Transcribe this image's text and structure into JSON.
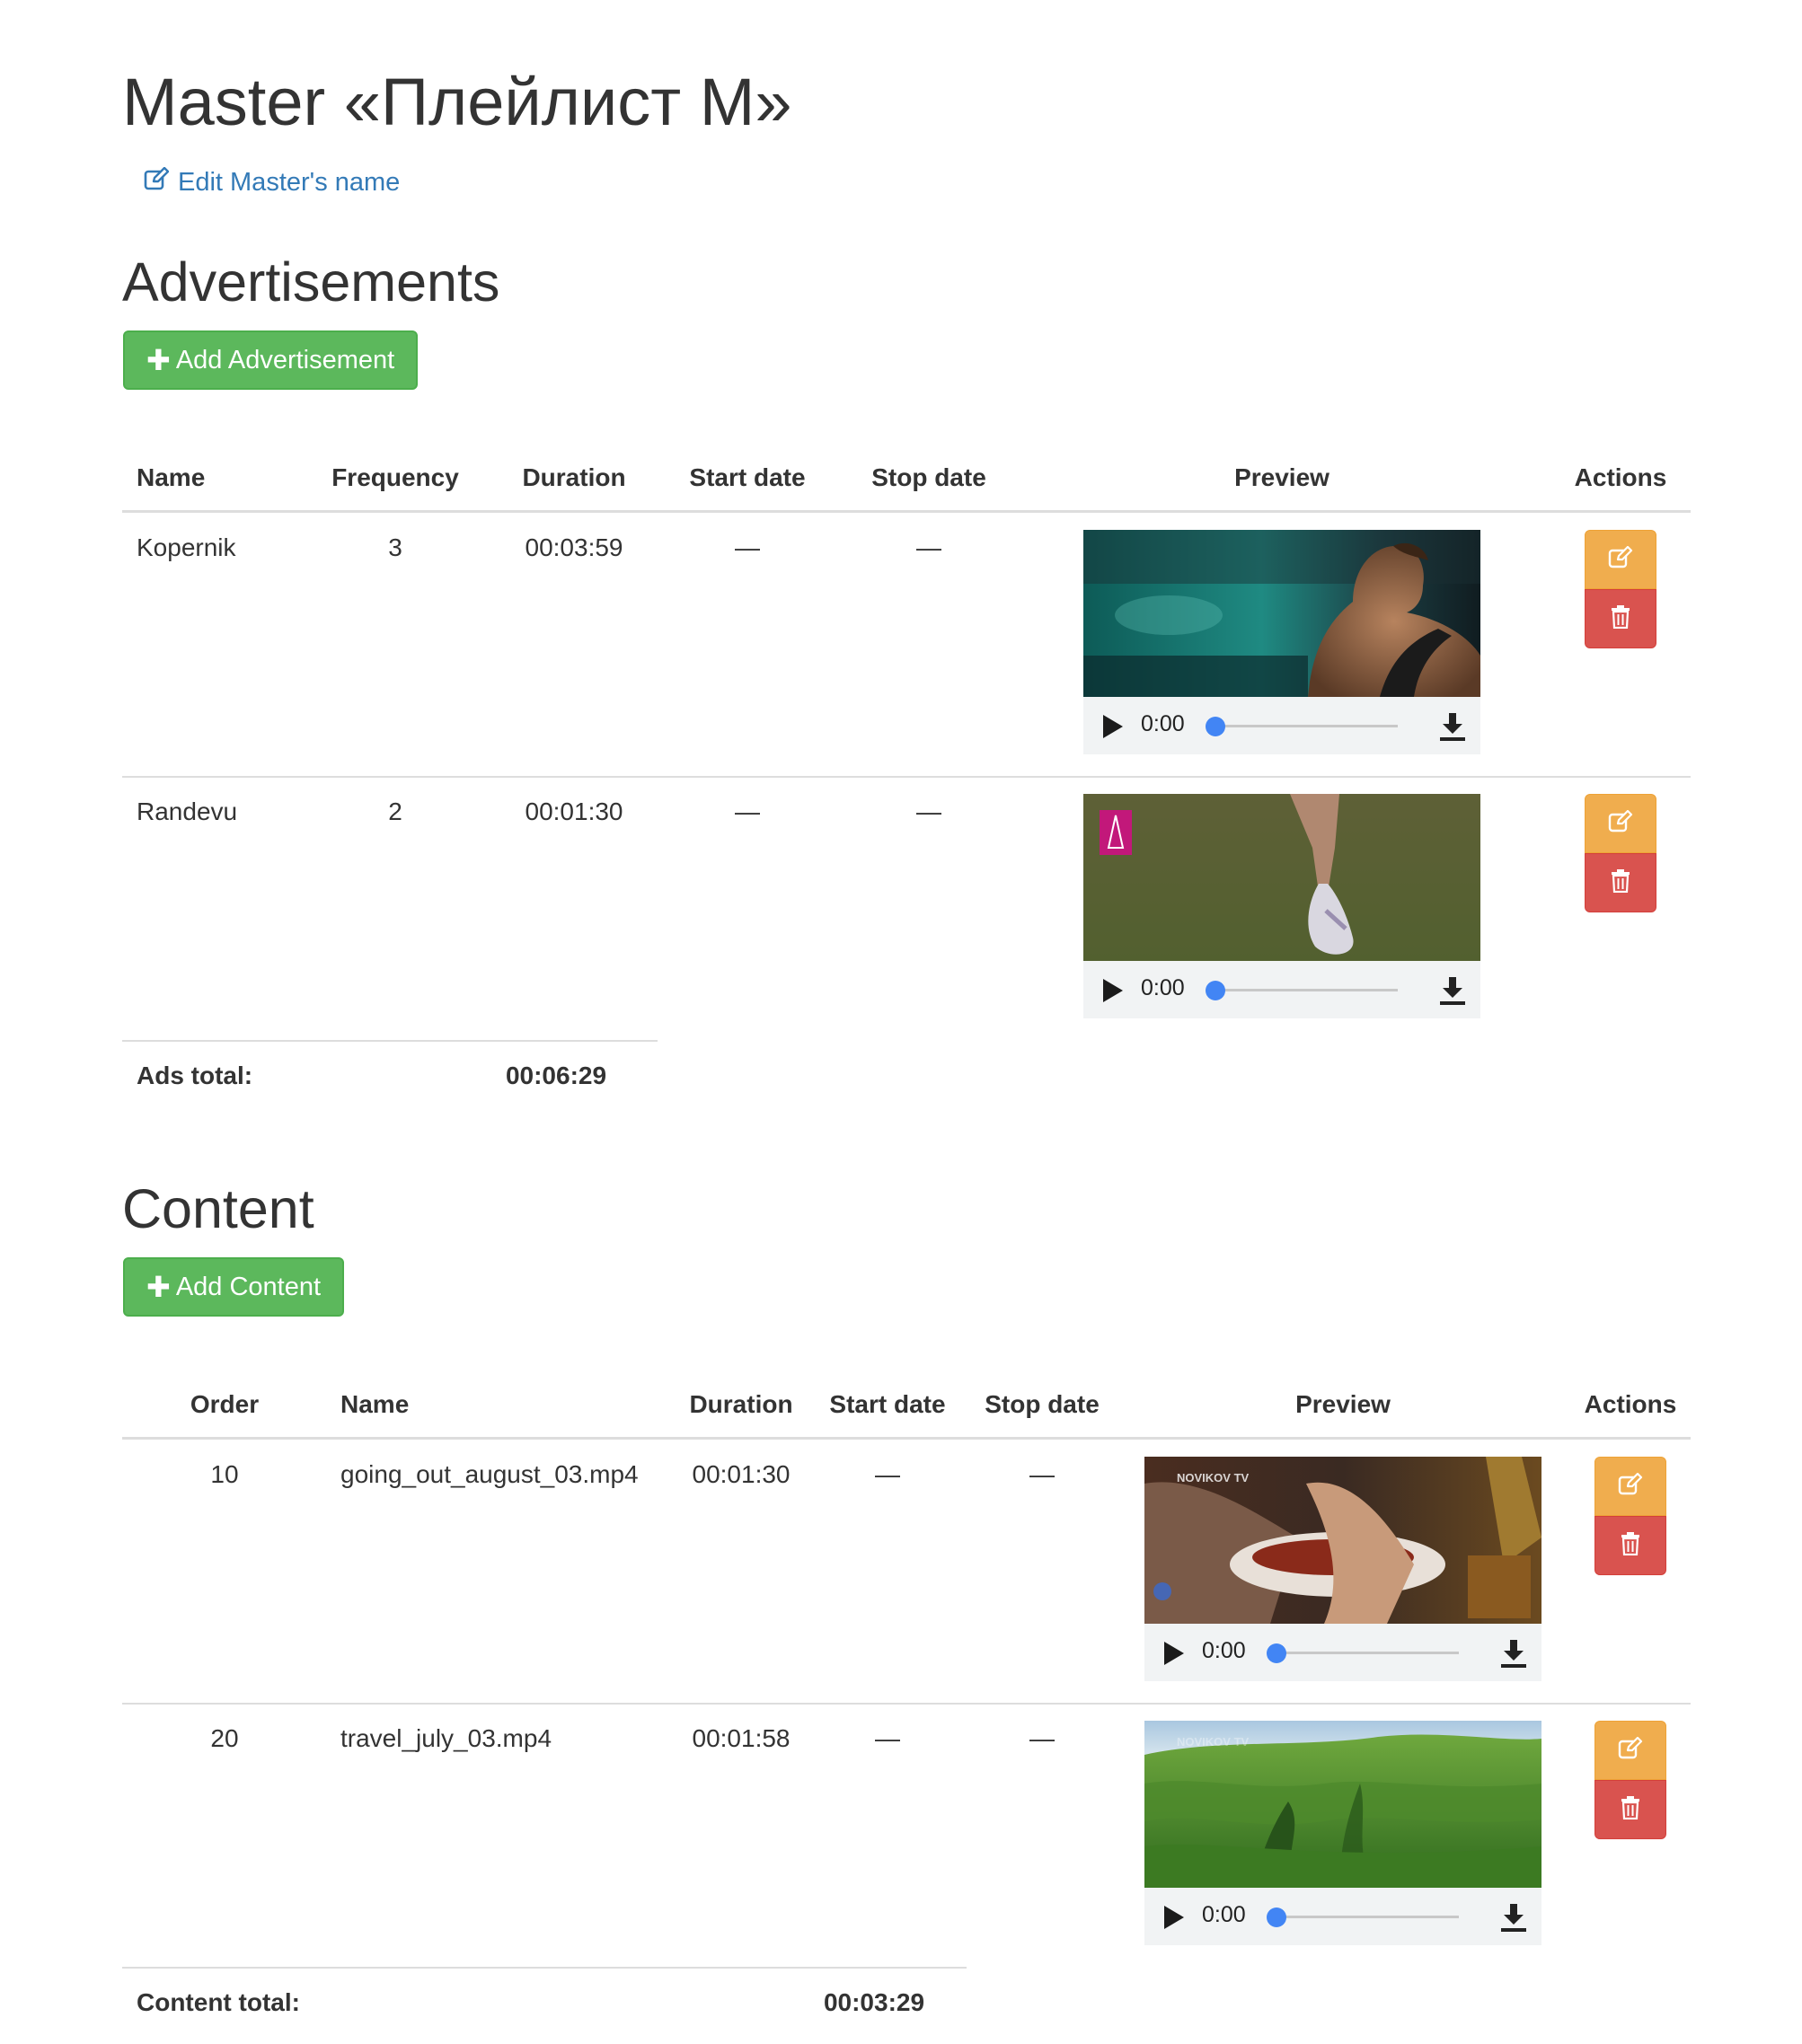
{
  "page": {
    "title": "Master «Плейлист М»",
    "edit_master_name": "Edit Master's name"
  },
  "ads": {
    "heading": "Advertisements",
    "add_label": "Add Advertisement",
    "columns": [
      "Name",
      "Frequency",
      "Duration",
      "Start date",
      "Stop date",
      "Preview",
      "Actions"
    ],
    "rows": [
      {
        "name": "Kopernik",
        "frequency": "3",
        "duration": "00:03:59",
        "start": "—",
        "stop": "—",
        "time": "0:00"
      },
      {
        "name": "Randevu",
        "frequency": "2",
        "duration": "00:01:30",
        "start": "—",
        "stop": "—",
        "time": "0:00"
      }
    ],
    "total_label": "Ads total:",
    "total_value": "00:06:29"
  },
  "content": {
    "heading": "Content",
    "add_label": "Add Content",
    "columns": [
      "Order",
      "Name",
      "Duration",
      "Start date",
      "Stop date",
      "Preview",
      "Actions"
    ],
    "rows": [
      {
        "order": "10",
        "name": "going_out_august_03.mp4",
        "duration": "00:01:30",
        "start": "—",
        "stop": "—",
        "time": "0:00",
        "watermark": "NOVIKOV TV"
      },
      {
        "order": "20",
        "name": "travel_july_03.mp4",
        "duration": "00:01:58",
        "start": "—",
        "stop": "—",
        "time": "0:00",
        "watermark": "NOVIKOV TV"
      }
    ],
    "total_label": "Content total:",
    "total_value": "00:03:29"
  },
  "colors": {
    "link": "#337ab7",
    "success": "#5cb85c",
    "warning": "#f0ad4e",
    "danger": "#d9534f",
    "progress_thumb": "#4285f4"
  },
  "icons": {
    "edit": "pencil-square-icon",
    "delete": "trash-icon",
    "add": "plus-icon",
    "play": "play-icon",
    "download": "download-icon"
  }
}
